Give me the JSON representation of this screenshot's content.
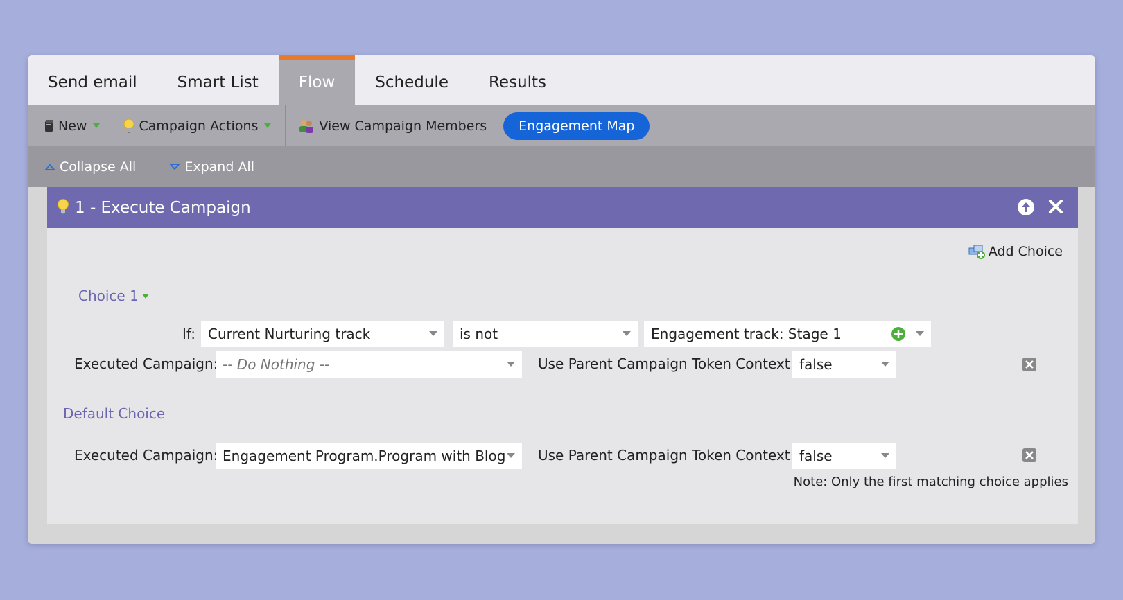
{
  "tabs": [
    {
      "label": "Send email",
      "active": false
    },
    {
      "label": "Smart List",
      "active": false
    },
    {
      "label": "Flow",
      "active": true
    },
    {
      "label": "Schedule",
      "active": false
    },
    {
      "label": "Results",
      "active": false
    }
  ],
  "toolbar": {
    "new_label": "New",
    "campaign_actions_label": "Campaign Actions",
    "view_members_label": "View Campaign Members",
    "engagement_map_label": "Engagement Map"
  },
  "toolbar2": {
    "collapse_label": "Collapse All",
    "expand_label": "Expand All"
  },
  "step": {
    "title": "1 - Execute Campaign",
    "add_choice_label": "Add Choice",
    "choice1": {
      "label": "Choice 1",
      "if_label": "If:",
      "field": "Current Nurturing track",
      "operator": "is not",
      "value": "Engagement track: Stage 1",
      "executed_label": "Executed Campaign:",
      "executed_value": "-- Do Nothing --",
      "token_label": "Use Parent Campaign Token Context:",
      "token_value": "false"
    },
    "default_choice": {
      "label": "Default Choice",
      "executed_label": "Executed Campaign:",
      "executed_value": "Engagement Program.Program with Blog",
      "token_label": "Use Parent Campaign Token Context:",
      "token_value": "false"
    },
    "note": "Note: Only the first matching choice applies"
  },
  "colors": {
    "background": "#a6aedb",
    "header": "#6f6aaf",
    "active_tab_accent": "#ea7a2b",
    "pill": "#1565d8"
  }
}
